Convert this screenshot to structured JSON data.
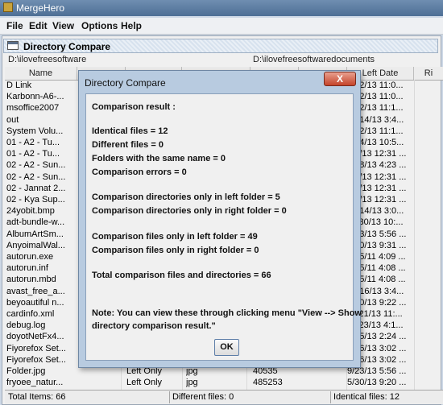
{
  "window": {
    "title": "MergeHero"
  },
  "menu": [
    "File",
    "Edit",
    "View",
    "Options",
    "Help"
  ],
  "panel": {
    "title": "Directory Compare"
  },
  "paths": {
    "left": "D:\\ilovefreesoftware",
    "right": "D:\\ilovefreesoftwaredocuments"
  },
  "columns": {
    "name": "Name",
    "left_date": "Left Date",
    "ri": "Ri"
  },
  "rows": [
    {
      "name": "D Link",
      "date": "12/2/13 11:0..."
    },
    {
      "name": "Karbonn-A6-...",
      "date": "12/2/13 11:0..."
    },
    {
      "name": "msoffice2007",
      "date": "12/2/13 11:1..."
    },
    {
      "name": "out",
      "date": "12/14/13 3:4..."
    },
    {
      "name": "System Volu...",
      "date": "12/2/13 11:1..."
    },
    {
      "name": "01 - A2 - Tu...",
      "date": "6/24/13 10:5..."
    },
    {
      "name": "01 - A2 - Tu...",
      "date": "6/1/13 12:31 ..."
    },
    {
      "name": "02 - A2 - Sun...",
      "date": "5/18/13 4:23 ..."
    },
    {
      "name": "02 - A2 - Sun...",
      "date": "6/1/13 12:31 ..."
    },
    {
      "name": "02 - Jannat 2...",
      "date": "6/1/13 12:31 ..."
    },
    {
      "name": "02 - Kya Sup...",
      "date": "6/1/13 12:31 ..."
    },
    {
      "name": "24yobit.bmp",
      "date": "12/14/13 3:0..."
    },
    {
      "name": "adt-bundle-w...",
      "date": "11/30/13 10:..."
    },
    {
      "name": "AlbumArtSm...",
      "date": "9/23/13 5:56 ..."
    },
    {
      "name": "AnyoimalWal...",
      "date": "5/30/13 9:31 ..."
    },
    {
      "name": "autorun.exe",
      "date": "9/15/11 4:09 ..."
    },
    {
      "name": "autorun.inf",
      "date": "9/15/11 4:08 ..."
    },
    {
      "name": "autorun.mbd",
      "date": "9/15/11 4:08 ..."
    },
    {
      "name": "avast_free_a...",
      "date": "10/16/13 3:4..."
    },
    {
      "name": "beyoautiful n...",
      "date": "5/30/13 9:22 ..."
    },
    {
      "name": "cardinfo.xml",
      "date": "11/21/13 11:..."
    },
    {
      "name": "debug.log",
      "date": "11/23/13 4:1..."
    },
    {
      "name": "doyotNetFx4...",
      "date": "2/25/13 2:24 ..."
    },
    {
      "name": "Fiyorefox Set...",
      "date": "2/26/13 3:02 ..."
    },
    {
      "name": "Fiyorefox Set...",
      "date": "2/26/13 3:02 ..."
    },
    {
      "name": "Folder.jpg",
      "date": "9/23/13 5:56 ...",
      "status": "Left Only",
      "type": "jpg",
      "size": "40535"
    },
    {
      "name": "fryoee_natur...",
      "date": "5/30/13 9:20 ...",
      "status": "Left Only",
      "type": "jpg",
      "size": "485253"
    }
  ],
  "status": {
    "total": "Total Items: 66",
    "different": "Different files: 0",
    "identical": "Identical files: 12"
  },
  "dialog": {
    "title": "Directory Compare",
    "close_label": "X",
    "lines": [
      "Comparison result :",
      "Identical files = 12",
      "Different files = 0",
      "Folders with the same name = 0",
      "Comparison errors = 0",
      "Comparison directories only in left folder = 5",
      "Comparison directories only in right folder = 0",
      "Comparison files only in left folder = 49",
      "Comparison files only in right folder = 0",
      "Total comparison files and directories = 66",
      "Note: You can view these through clicking menu \"View --> Show",
      "directory comparison result.\""
    ],
    "ok_label": "OK"
  },
  "colors": {
    "titlebar": "#5b7ba1",
    "close": "#c8432a",
    "dialog_frame": "#b8cbe0"
  }
}
